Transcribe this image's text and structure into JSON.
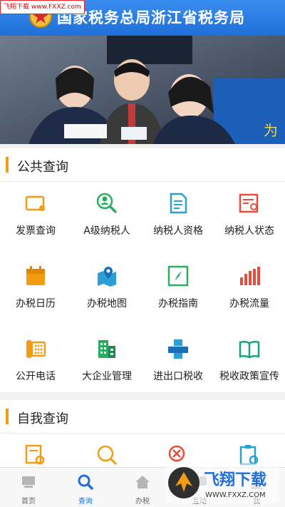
{
  "watermark_top": "飞翔下载 www.FXXZ.com",
  "header": {
    "title": "国家税务总局浙江省税务局"
  },
  "banner": {
    "sign_text": "为"
  },
  "public_query": {
    "title": "公共查询",
    "items": [
      {
        "label": "发票查询",
        "icon": "invoice-search-icon"
      },
      {
        "label": "A级纳税人",
        "icon": "person-search-icon"
      },
      {
        "label": "纳税人资格",
        "icon": "document-icon"
      },
      {
        "label": "纳税人状态",
        "icon": "status-card-icon"
      },
      {
        "label": "办税日历",
        "icon": "calendar-icon"
      },
      {
        "label": "办税地图",
        "icon": "map-pin-icon"
      },
      {
        "label": "办税指南",
        "icon": "compass-icon"
      },
      {
        "label": "办税流量",
        "icon": "bar-chart-icon"
      },
      {
        "label": "公开电话",
        "icon": "phone-icon"
      },
      {
        "label": "大企业管理",
        "icon": "building-icon"
      },
      {
        "label": "进出口税收",
        "icon": "import-export-icon"
      },
      {
        "label": "税收政策宣传",
        "icon": "book-icon"
      }
    ]
  },
  "self_query": {
    "title": "自我查询",
    "items": [
      {
        "icon": "form-search-icon"
      },
      {
        "icon": "tax-search-icon"
      },
      {
        "icon": "cancel-search-icon"
      },
      {
        "icon": "clipboard-search-icon"
      }
    ]
  },
  "tabbar": {
    "items": [
      {
        "label": "首页",
        "icon": "home-icon"
      },
      {
        "label": "查询",
        "icon": "search-icon"
      },
      {
        "label": "办税",
        "icon": "house-icon"
      },
      {
        "label": "互动",
        "icon": "chat-icon"
      },
      {
        "label": "我",
        "icon": "user-icon"
      }
    ]
  },
  "watermark_bottom": {
    "title": "飞翔下载",
    "url": "WWW.FXXZ.COM"
  },
  "colors": {
    "header_blue": "#1e6fd8",
    "accent_orange": "#f39c12",
    "active_tab": "#1e6fd8"
  }
}
